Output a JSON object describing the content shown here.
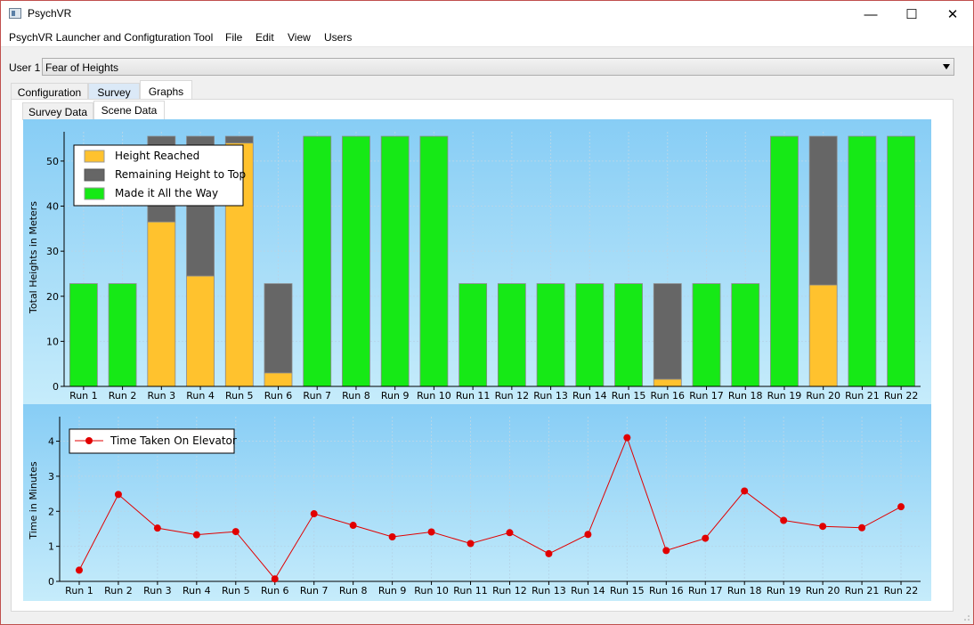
{
  "window": {
    "title": "PsychVR",
    "minimize_glyph": "—",
    "maximize_glyph": "☐",
    "close_glyph": "✕"
  },
  "menu": [
    "PsychVR Launcher and Configturation Tool",
    "File",
    "Edit",
    "View",
    "Users"
  ],
  "user": {
    "label": "User 1",
    "selected_scene": "Fear of Heights"
  },
  "tabs": [
    {
      "label": "Configuration",
      "selected": false
    },
    {
      "label": "Survey",
      "selected": false
    },
    {
      "label": "Graphs",
      "selected": true
    }
  ],
  "subtabs": [
    {
      "label": "Survey Data",
      "selected": false
    },
    {
      "label": "Scene Data",
      "selected": true
    }
  ],
  "colors": {
    "chart_bg_top": "#87cdf5",
    "chart_bg_bottom": "#c6ecfb",
    "height_reached": "#ffc22e",
    "remaining": "#666666",
    "made_it": "#16e916",
    "line": "#e10000"
  },
  "chart_data": [
    {
      "type": "bar",
      "stacked": true,
      "categories": [
        "Run 1",
        "Run 2",
        "Run 3",
        "Run 4",
        "Run 5",
        "Run 6",
        "Run 7",
        "Run 8",
        "Run 9",
        "Run 10",
        "Run 11",
        "Run 12",
        "Run 13",
        "Run 14",
        "Run 15",
        "Run 16",
        "Run 17",
        "Run 18",
        "Run 19",
        "Run 20",
        "Run 21",
        "Run 22"
      ],
      "series": [
        {
          "name": "Height Reached",
          "values": [
            0,
            0,
            36.5,
            24.5,
            54,
            3,
            0,
            0,
            0,
            0,
            0,
            0,
            0,
            0,
            0,
            1.6,
            0,
            0,
            0,
            22.5,
            0,
            0
          ]
        },
        {
          "name": "Remaining Height to Top",
          "values": [
            0,
            0,
            19,
            31,
            1.5,
            19.8,
            0,
            0,
            0,
            0,
            0,
            0,
            0,
            0,
            0,
            21.2,
            0,
            0,
            0,
            33,
            0,
            0
          ]
        },
        {
          "name": "Made it All the Way",
          "values": [
            22.8,
            22.8,
            0,
            0,
            0,
            0,
            55.5,
            55.5,
            55.5,
            55.5,
            22.8,
            22.8,
            22.8,
            22.8,
            22.8,
            0,
            22.8,
            22.8,
            55.5,
            0,
            55.5,
            55.5
          ]
        }
      ],
      "ylabel": "Total Heights in Meters",
      "ylim": [
        0,
        56.5
      ],
      "yticks": [
        0,
        10,
        20,
        30,
        40,
        50
      ],
      "grid": true,
      "legend_position": "top-left"
    },
    {
      "type": "line",
      "categories": [
        "Run 1",
        "Run 2",
        "Run 3",
        "Run 4",
        "Run 5",
        "Run 6",
        "Run 7",
        "Run 8",
        "Run 9",
        "Run 10",
        "Run 11",
        "Run 12",
        "Run 13",
        "Run 14",
        "Run 15",
        "Run 16",
        "Run 17",
        "Run 18",
        "Run 19",
        "Run 20",
        "Run 21",
        "Run 22"
      ],
      "series": [
        {
          "name": "Time Taken On Elevator",
          "values": [
            0.32,
            2.48,
            1.52,
            1.33,
            1.42,
            0.07,
            1.93,
            1.6,
            1.27,
            1.41,
            1.08,
            1.39,
            0.79,
            1.34,
            4.1,
            0.88,
            1.23,
            2.58,
            1.74,
            1.57,
            1.53,
            2.13
          ]
        }
      ],
      "ylabel": "Time in Minutes",
      "ylim": [
        0,
        4.7
      ],
      "yticks": [
        0,
        1,
        2,
        3,
        4
      ],
      "grid": true,
      "legend_position": "top-left"
    }
  ]
}
